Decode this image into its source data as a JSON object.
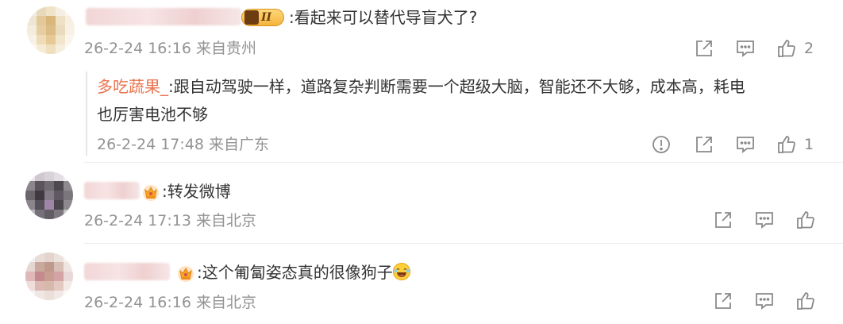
{
  "comments": [
    {
      "text": ":看起来可以替代导盲犬了?",
      "meta": "26-2-24 16:16 来自贵州",
      "like_count": "2",
      "badge_level": "II",
      "reply": {
        "name": "多吃蔬果_",
        "text_line1": ":跟自动驾驶一样，道路复杂判断需要一个超级大脑，智能还不大够，成本高，耗电",
        "text_line2": "也厉害电池不够",
        "meta": "26-2-24 17:48 来自广东",
        "like_count": "1"
      }
    },
    {
      "text": ":转发微博",
      "meta": "26-2-24 17:13 来自北京"
    },
    {
      "text": ":这个匍匐姿态真的很像狗子",
      "meta": "26-2-24 16:16 来自北京"
    }
  ],
  "colors": {
    "reply_name": "#eb7350",
    "meta_text": "#939393",
    "icon_stroke": "#8a8a8a"
  },
  "icons": [
    "share-icon",
    "comment-icon",
    "like-icon",
    "report-icon",
    "crown-icon",
    "laugh-emoji"
  ]
}
